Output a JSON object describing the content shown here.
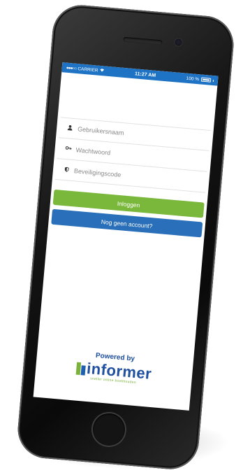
{
  "status_bar": {
    "carrier": "CARRIER",
    "time": "11:27 AM",
    "battery": "100 %"
  },
  "login_form": {
    "username_placeholder": "Gebruikersnaam",
    "password_placeholder": "Wachtwoord",
    "security_code_placeholder": "Beveiligingscode",
    "login_button": "Inloggen",
    "register_button": "Nog geen account?"
  },
  "branding": {
    "powered_by": "Powered by",
    "brand_name": "informer",
    "tagline": "sneller online boekhouden"
  },
  "icons": {
    "username": "user-icon",
    "password": "key-icon",
    "security_code": "shield-icon"
  },
  "colors": {
    "status_bar": "#1f73c4",
    "login_button": "#79b83a",
    "register_button": "#2a6fb9",
    "brand_blue": "#1f4fa0",
    "brand_green": "#7ab23a"
  }
}
